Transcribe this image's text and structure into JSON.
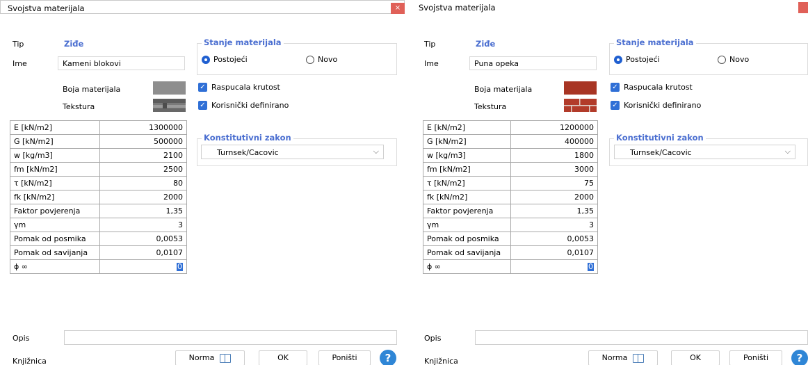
{
  "dialogs": [
    {
      "title": "Svojstva materijala",
      "close_label": "×",
      "tip_label": "Tip",
      "tip_value": "Ziđe",
      "ime_label": "Ime",
      "ime_value": "Kameni blokovi",
      "boja_label": "Boja materijala",
      "tekstura_label": "Tekstura",
      "color": "#8e8e8e",
      "stanje": {
        "title": "Stanje materijala",
        "postojeci": "Postojeći",
        "novo": "Novo",
        "selected": "Postojeći"
      },
      "raspucala": "Raspucala krutost",
      "korisnicki": "Korisnički definirano",
      "zakon": {
        "title": "Konstitutivni zakon",
        "value": "Turnsek/Cacovic"
      },
      "props": [
        {
          "label": "E [kN/m2]",
          "value": "1300000"
        },
        {
          "label": "G [kN/m2]",
          "value": "500000"
        },
        {
          "label": "w [kg/m3]",
          "value": "2100"
        },
        {
          "label": "fm [kN/m2]",
          "value": "2500"
        },
        {
          "label": "τ [kN/m2]",
          "value": "80"
        },
        {
          "label": "fk [kN/m2]",
          "value": "2000"
        },
        {
          "label": "Faktor povjerenja",
          "value": "1,35"
        },
        {
          "label": "γm",
          "value": "3"
        },
        {
          "label": "Pomak od posmika",
          "value": "0,0053"
        },
        {
          "label": "Pomak od savijanja",
          "value": "0,0107"
        },
        {
          "label": "ϕ ∞",
          "value": "0"
        }
      ],
      "opis_label": "Opis",
      "knjiznica_label": "Knjižnica",
      "norma_label": "Norma",
      "ok_label": "OK",
      "ponisti_label": "Poništi",
      "help_label": "?"
    },
    {
      "title": "Svojstva materijala",
      "close_label": "",
      "tip_label": "Tip",
      "tip_value": "Ziđe",
      "ime_label": "Ime",
      "ime_value": "Puna opeka",
      "boja_label": "Boja materijala",
      "tekstura_label": "Tekstura",
      "color": "#a83524",
      "stanje": {
        "title": "Stanje materijala",
        "postojeci": "Postojeći",
        "novo": "Novo",
        "selected": "Postojeći"
      },
      "raspucala": "Raspucala krutost",
      "korisnicki": "Korisnički definirano",
      "zakon": {
        "title": "Konstitutivni zakon",
        "value": "Turnsek/Cacovic"
      },
      "props": [
        {
          "label": "E [kN/m2]",
          "value": "1200000"
        },
        {
          "label": "G [kN/m2]",
          "value": "400000"
        },
        {
          "label": "w [kg/m3]",
          "value": "1800"
        },
        {
          "label": "fm [kN/m2]",
          "value": "3000"
        },
        {
          "label": "τ [kN/m2]",
          "value": "75"
        },
        {
          "label": "fk [kN/m2]",
          "value": "2000"
        },
        {
          "label": "Faktor povjerenja",
          "value": "1,35"
        },
        {
          "label": "γm",
          "value": "3"
        },
        {
          "label": "Pomak od posmika",
          "value": "0,0053"
        },
        {
          "label": "Pomak od savijanja",
          "value": "0,0107"
        },
        {
          "label": "ϕ ∞",
          "value": "0"
        }
      ],
      "opis_label": "Opis",
      "knjiznica_label": "Knjižnica",
      "norma_label": "Norma",
      "ok_label": "OK",
      "ponisti_label": "Poništi",
      "help_label": "?"
    }
  ]
}
